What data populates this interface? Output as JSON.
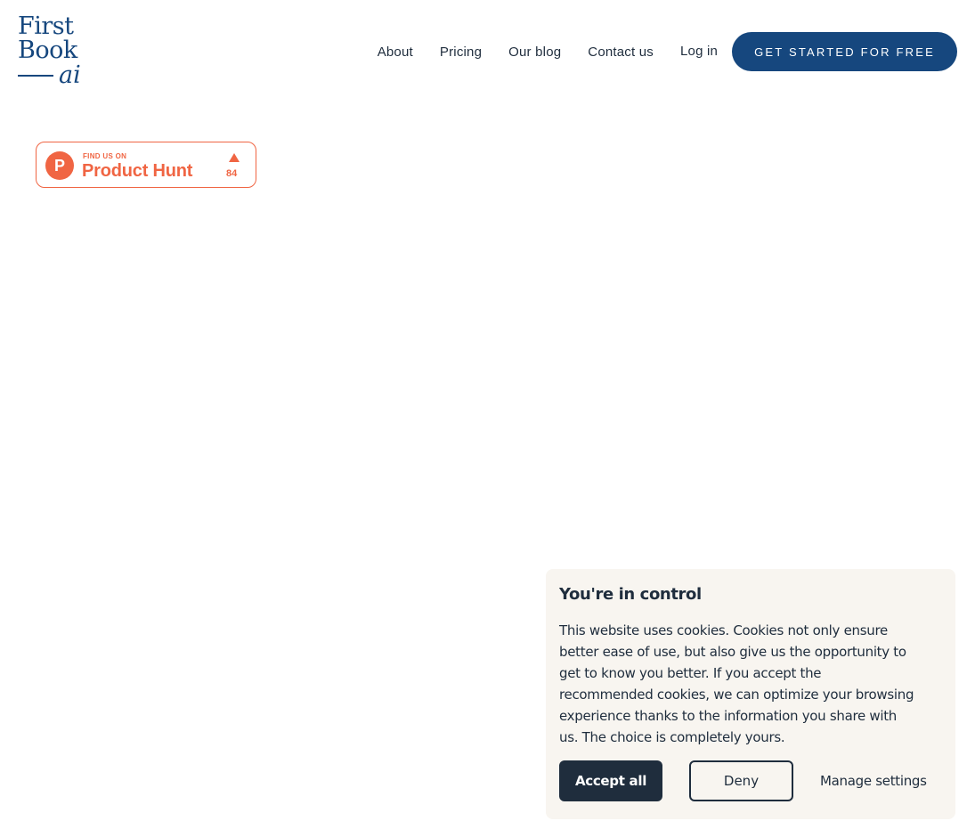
{
  "logo": {
    "line1": "First",
    "line2": "Book",
    "line3": "ai"
  },
  "nav": {
    "items": [
      {
        "label": "About"
      },
      {
        "label": "Pricing"
      },
      {
        "label": "Our blog"
      },
      {
        "label": "Contact us"
      }
    ],
    "login": "Log in",
    "cta": "GET STARTED FOR FREE"
  },
  "product_hunt": {
    "find_us": "FIND US ON",
    "name": "Product Hunt",
    "upvotes": "84"
  },
  "cookie": {
    "title": "You're in control",
    "text": "This website uses cookies. Cookies not only ensure better ease of use, but also give us the opportunity to get to know you better. If you accept the recommended cookies, we can optimize your browsing experience thanks to the information you share with us. The choice is completely yours.",
    "accept": "Accept all",
    "deny": "Deny",
    "manage": "Manage settings"
  },
  "colors": {
    "brand": "#16477e",
    "product_hunt": "#f06543",
    "cookie_bg": "#f8f5f0",
    "dark": "#1f2d3d"
  }
}
